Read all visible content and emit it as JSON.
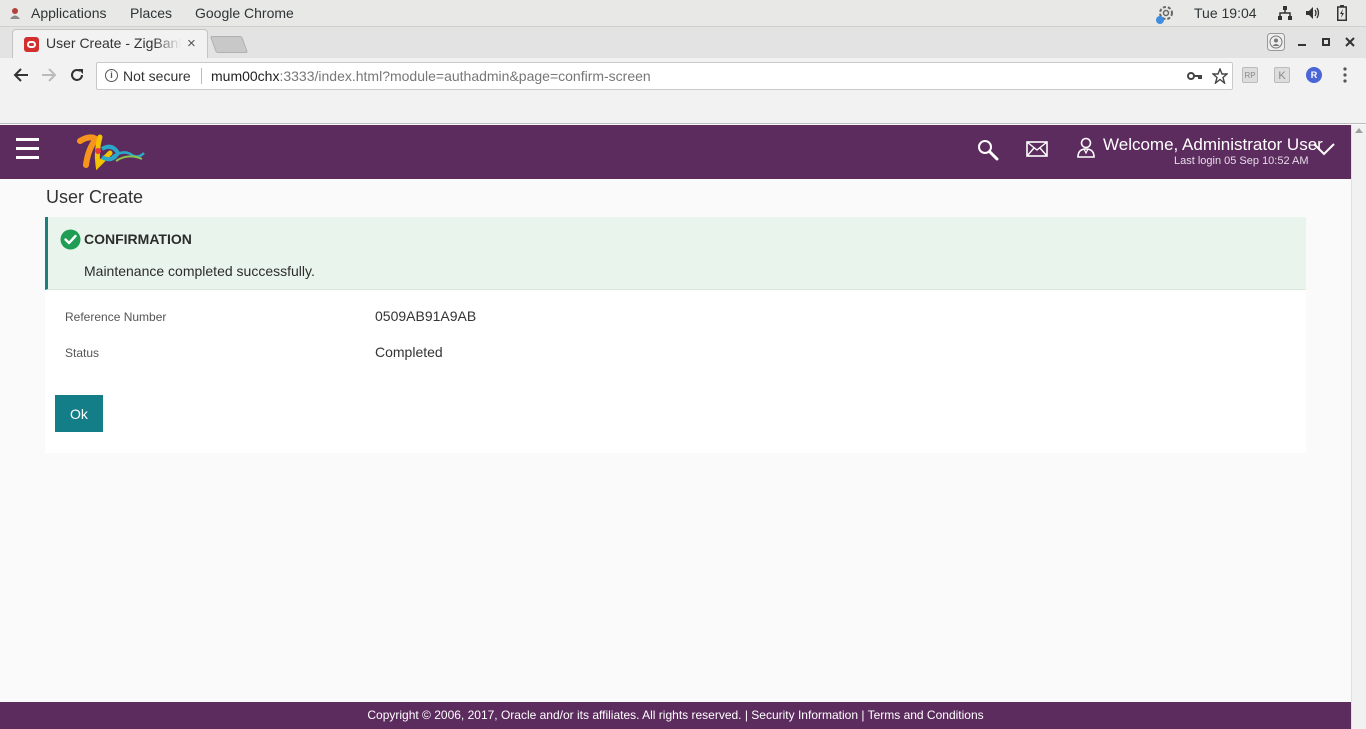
{
  "os_bar": {
    "applications": "Applications",
    "places": "Places",
    "chrome": "Google Chrome",
    "clock": "Tue 19:04"
  },
  "browser": {
    "tab_title": "User Create - ZigBank",
    "tab_close": "×",
    "omnibox": {
      "security": "Not secure",
      "host": "mum00chx",
      "path": ":3333/index.html?module=authadmin&page=confirm-screen"
    },
    "extensions": [
      "RP",
      "K",
      "R"
    ]
  },
  "header": {
    "welcome": "Welcome, Administrator User",
    "last_login": "Last login 05 Sep 10:52 AM"
  },
  "page": {
    "title": "User Create",
    "alert": {
      "title": "CONFIRMATION",
      "message": "Maintenance completed successfully."
    },
    "fields": [
      {
        "label": "Reference Number",
        "value": "0509AB91A9AB"
      },
      {
        "label": "Status",
        "value": "Completed"
      }
    ],
    "ok_label": "Ok"
  },
  "footer": {
    "copyright": "Copyright © 2006, 2017, Oracle and/or its affiliates. All rights reserved. | Security Information | Terms and Conditions"
  },
  "colors": {
    "brand": "#5c2c5e",
    "button": "#137e88",
    "success": "#1f9d55",
    "alert_bg": "#e9f5ec"
  }
}
